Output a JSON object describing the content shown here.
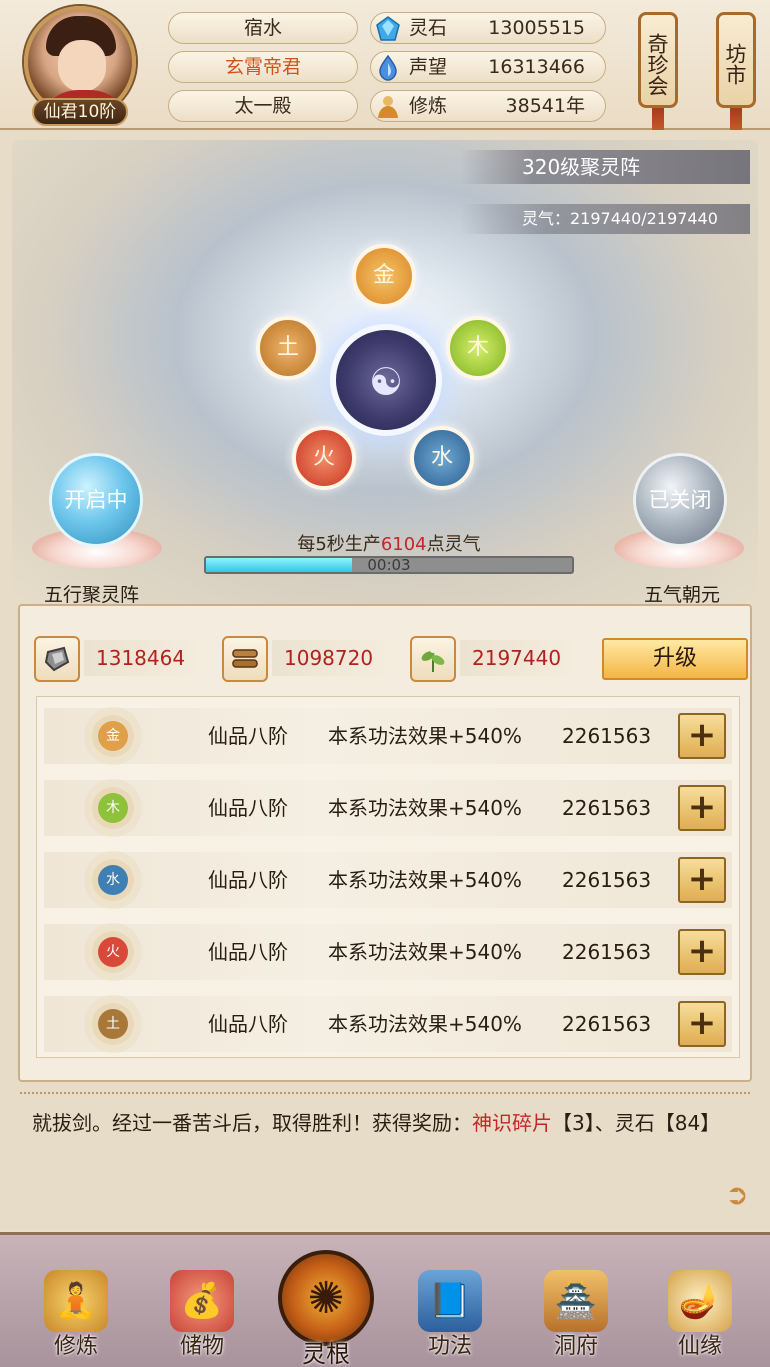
{
  "header": {
    "rank": "仙君10阶",
    "name": "宿水",
    "title": "玄霄帝君",
    "sect": "太一殿",
    "resources": [
      {
        "label": "灵石",
        "value": "13005515",
        "icon": "spirit-stone-icon"
      },
      {
        "label": "声望",
        "value": "16313466",
        "icon": "prestige-icon"
      },
      {
        "label": "修炼",
        "value": "38541年",
        "icon": "cultivation-icon"
      }
    ],
    "signs": [
      "奇珍会",
      "坊市"
    ]
  },
  "array": {
    "level": "320级聚灵阵",
    "qi": "灵气：2197440/2197440",
    "elements": [
      "金",
      "木",
      "水",
      "火",
      "土"
    ],
    "left_toggle": {
      "state": "开启中",
      "name": "五行聚灵阵"
    },
    "right_toggle": {
      "state": "已关闭",
      "name": "五气朝元"
    },
    "produce_prefix": "每5秒生产",
    "produce_value": "6104",
    "produce_suffix": "点灵气",
    "timer": "00:03",
    "timer_progress": 0.4
  },
  "materials": [
    {
      "value": "1318464",
      "icon": "ore-icon"
    },
    {
      "value": "1098720",
      "icon": "wood-logs-icon"
    },
    {
      "value": "2197440",
      "icon": "herb-icon"
    }
  ],
  "upgrade_label": "升级",
  "element_rows": [
    {
      "element": "金",
      "grade": "仙品八阶",
      "effect": "本系功法效果+540%",
      "cost": "2261563",
      "color": "#e0a04a"
    },
    {
      "element": "木",
      "grade": "仙品八阶",
      "effect": "本系功法效果+540%",
      "cost": "2261563",
      "color": "#8ec23a"
    },
    {
      "element": "水",
      "grade": "仙品八阶",
      "effect": "本系功法效果+540%",
      "cost": "2261563",
      "color": "#3f7fb4"
    },
    {
      "element": "火",
      "grade": "仙品八阶",
      "effect": "本系功法效果+540%",
      "cost": "2261563",
      "color": "#d8493a"
    },
    {
      "element": "土",
      "grade": "仙品八阶",
      "effect": "本系功法效果+540%",
      "cost": "2261563",
      "color": "#a8773a"
    }
  ],
  "log": {
    "prefix": "就拔剑。经过一番苦斗后，取得胜利！获得奖励：",
    "reward1": "神识碎片",
    "reward1_qty": "【3】",
    "sep": "、灵石",
    "reward2_qty": "【84】"
  },
  "nav": [
    {
      "label": "修炼",
      "icon": "meditating-monk-icon"
    },
    {
      "label": "储物",
      "icon": "treasure-bag-icon"
    },
    {
      "label": "灵根",
      "icon": "triskelion-icon"
    },
    {
      "label": "功法",
      "icon": "scripture-book-icon"
    },
    {
      "label": "洞府",
      "icon": "pavilion-icon"
    },
    {
      "label": "仙缘",
      "icon": "gourd-icon"
    }
  ]
}
